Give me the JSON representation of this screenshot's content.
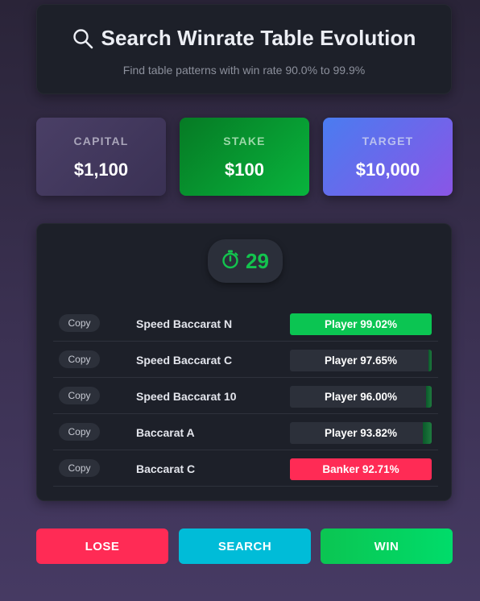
{
  "header": {
    "title": "Search Winrate Table Evolution",
    "subtitle": "Find table patterns with win rate 90.0% to 99.9%",
    "icon": "search-icon"
  },
  "stats": {
    "capital": {
      "label": "CAPITAL",
      "value": "$1,100"
    },
    "stake": {
      "label": "STAKE",
      "value": "$100"
    },
    "target": {
      "label": "TARGET",
      "value": "$10,000"
    }
  },
  "timer": {
    "icon": "stopwatch-icon",
    "value": "29",
    "color": "#13c44e"
  },
  "tables": [
    {
      "copy_label": "Copy",
      "name": "Speed Baccarat N",
      "result": "Player 99.02%",
      "style": "green",
      "fill": 0.0
    },
    {
      "copy_label": "Copy",
      "name": "Speed Baccarat C",
      "result": "Player 97.65%",
      "style": "dark",
      "fill": 0.02
    },
    {
      "copy_label": "Copy",
      "name": "Speed Baccarat 10",
      "result": "Player 96.00%",
      "style": "dark",
      "fill": 0.04
    },
    {
      "copy_label": "Copy",
      "name": "Baccarat A",
      "result": "Player 93.82%",
      "style": "dark",
      "fill": 0.06
    },
    {
      "copy_label": "Copy",
      "name": "Baccarat C",
      "result": "Banker 92.71%",
      "style": "red",
      "fill": 0.0
    }
  ],
  "actions": {
    "lose_label": "LOSE",
    "search_label": "SEARCH",
    "win_label": "WIN"
  },
  "colors": {
    "win_green": "#0bc552",
    "lose_red": "#ff2b55",
    "search_cyan": "#00bcd8"
  }
}
